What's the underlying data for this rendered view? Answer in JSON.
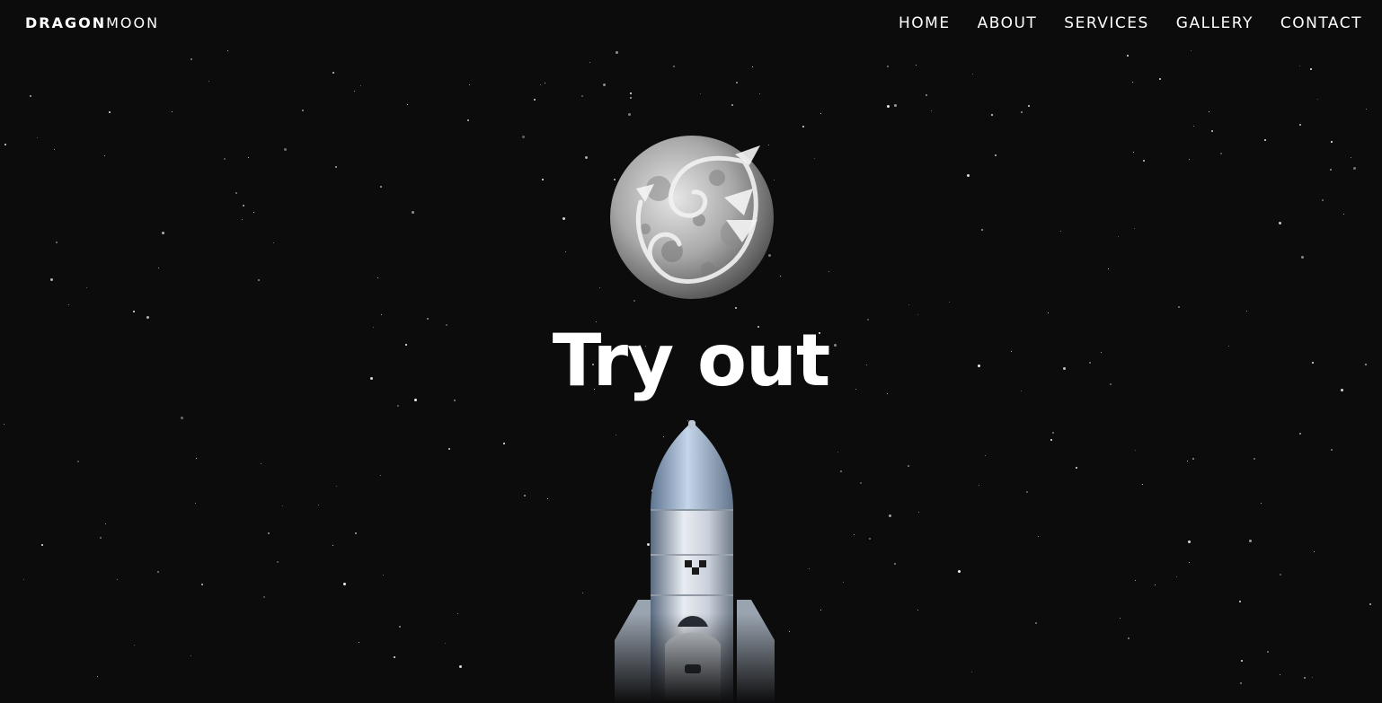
{
  "brand": {
    "bold": "DRAGON",
    "light": "MOON"
  },
  "nav": {
    "items": [
      "HOME",
      "ABOUT",
      "SERVICES",
      "GALLERY",
      "CONTACT"
    ]
  },
  "hero": {
    "headline": "Try out",
    "moon_icon": "dragon-moon-emblem",
    "rocket_icon": "rocket-illustration"
  },
  "colors": {
    "background": "#0c0c0d",
    "text": "#ffffff"
  }
}
